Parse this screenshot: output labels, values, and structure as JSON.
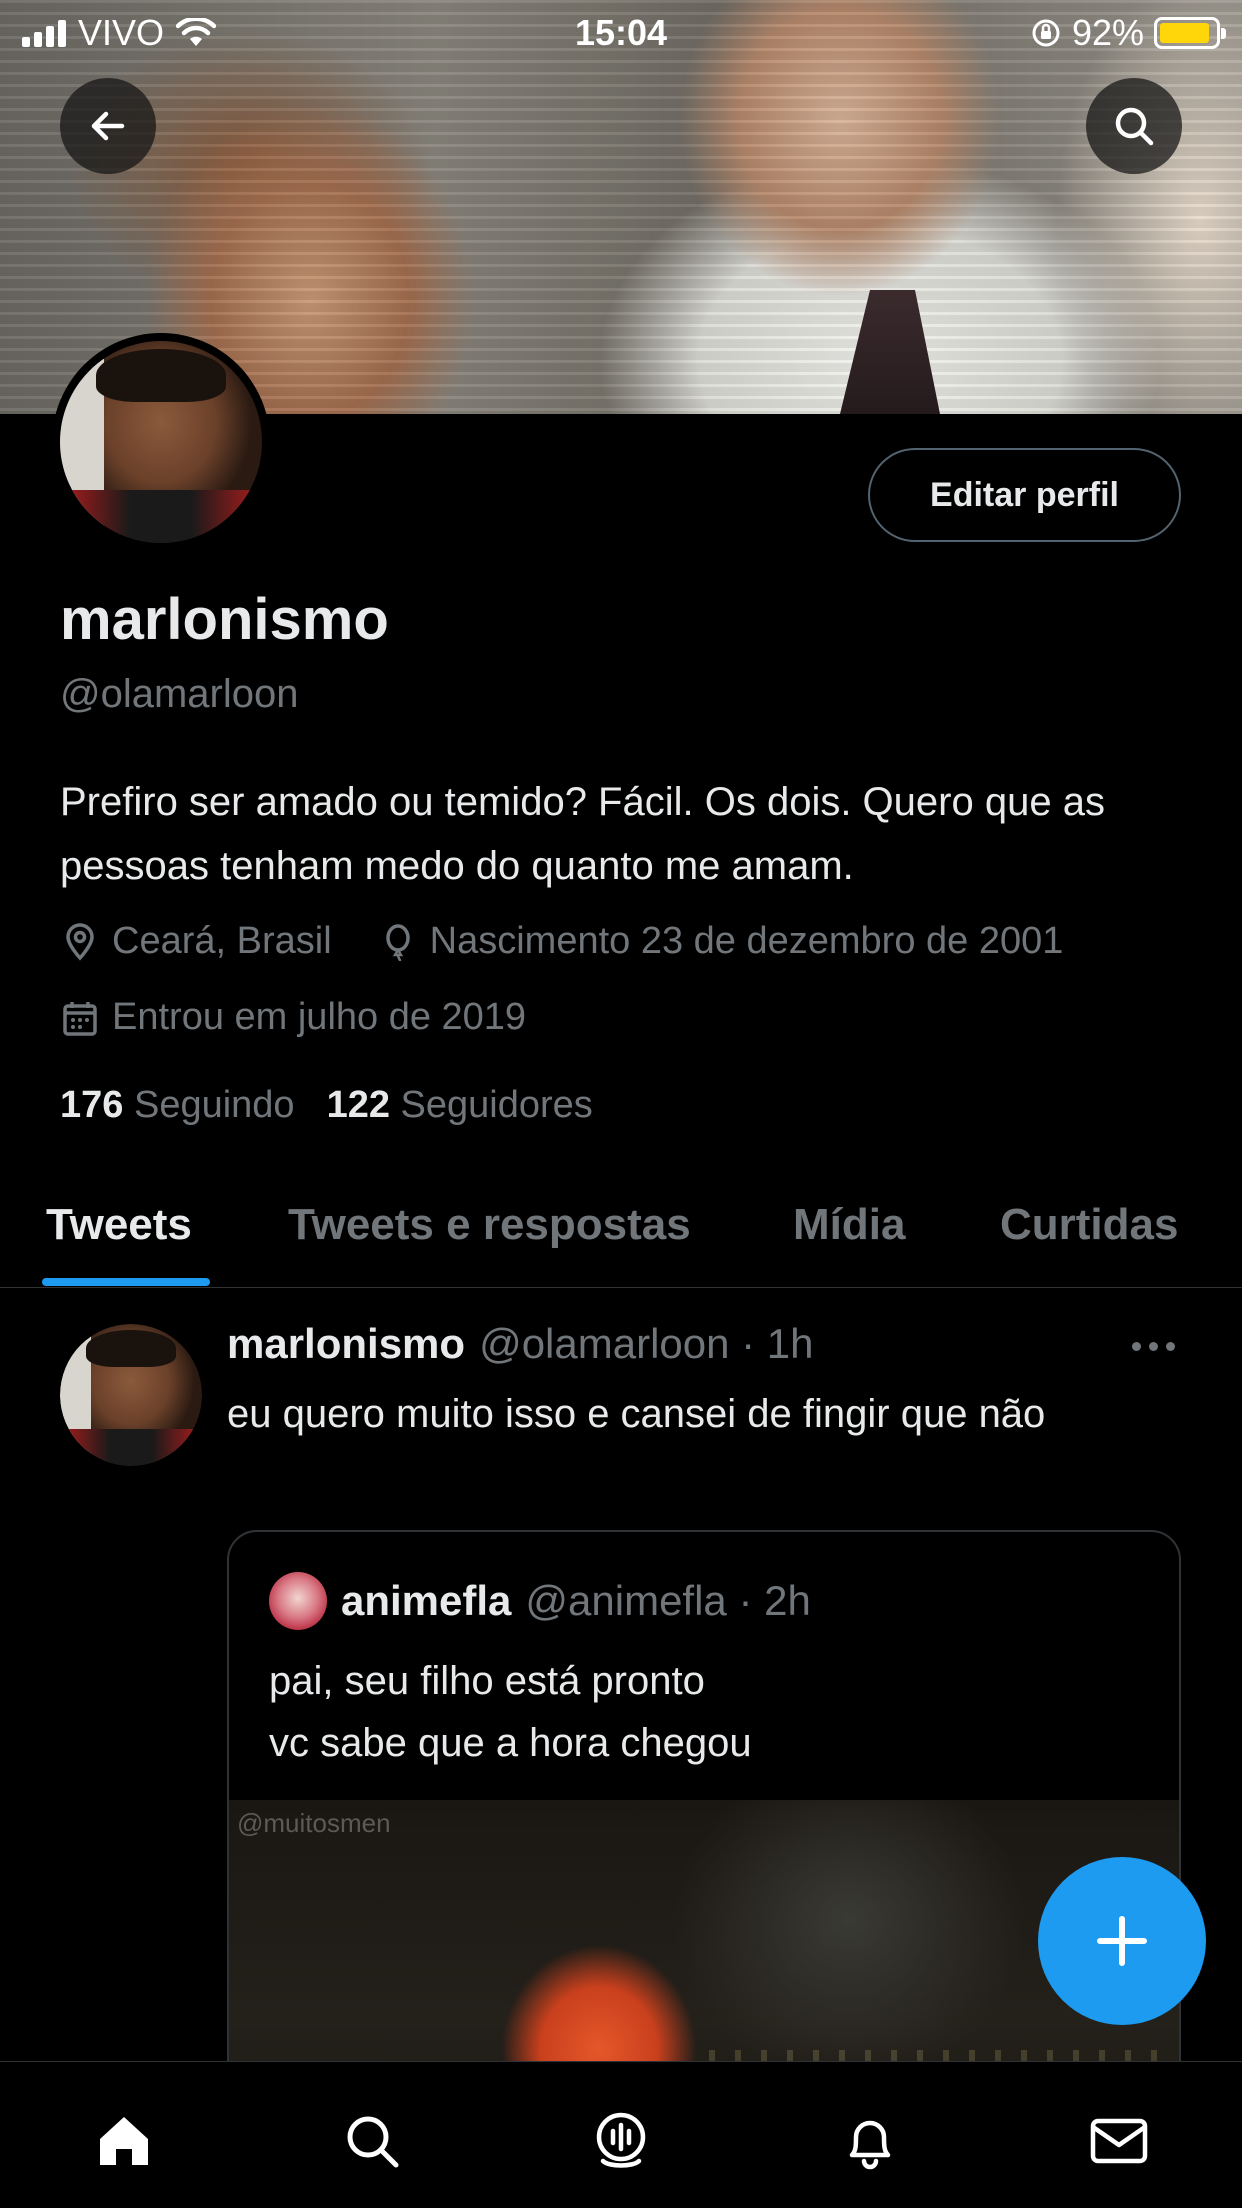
{
  "status_bar": {
    "carrier": "VIVO",
    "time": "15:04",
    "battery": "92%"
  },
  "profile": {
    "edit_button": "Editar perfil",
    "name": "marlonismo",
    "handle": "@olamarloon",
    "bio": "Prefiro ser amado ou temido? Fácil. Os dois. Quero que as pessoas tenham medo do quanto me amam.",
    "location": "Ceará, Brasil",
    "birthday": "Nascimento 23 de dezembro de 2001",
    "joined": "Entrou em julho de 2019",
    "following_count": "176",
    "following_label": "Seguindo",
    "followers_count": "122",
    "followers_label": "Seguidores"
  },
  "tabs": [
    {
      "label": "Tweets",
      "active": true
    },
    {
      "label": "Tweets e respostas",
      "active": false
    },
    {
      "label": "Mídia",
      "active": false
    },
    {
      "label": "Curtidas",
      "active": false
    }
  ],
  "tweet": {
    "name": "marlonismo",
    "meta": "@olamarloon · 1h",
    "text": "eu quero muito isso e cansei de fingir que não",
    "quote": {
      "name": "animefla",
      "meta": "@animefla · 2h",
      "line1": "pai, seu filho está pronto",
      "line2": "vc sabe que a hora chegou",
      "watermark": "@muitosmen"
    }
  },
  "colors": {
    "accent": "#1d9bf0",
    "background": "#000000",
    "secondary_text": "#71767b"
  },
  "icons": {
    "back": "arrow-left-icon",
    "search": "search-icon",
    "compose": "plus-icon",
    "nav": [
      "home-icon",
      "search-icon",
      "spaces-icon",
      "notifications-icon",
      "messages-icon"
    ]
  }
}
